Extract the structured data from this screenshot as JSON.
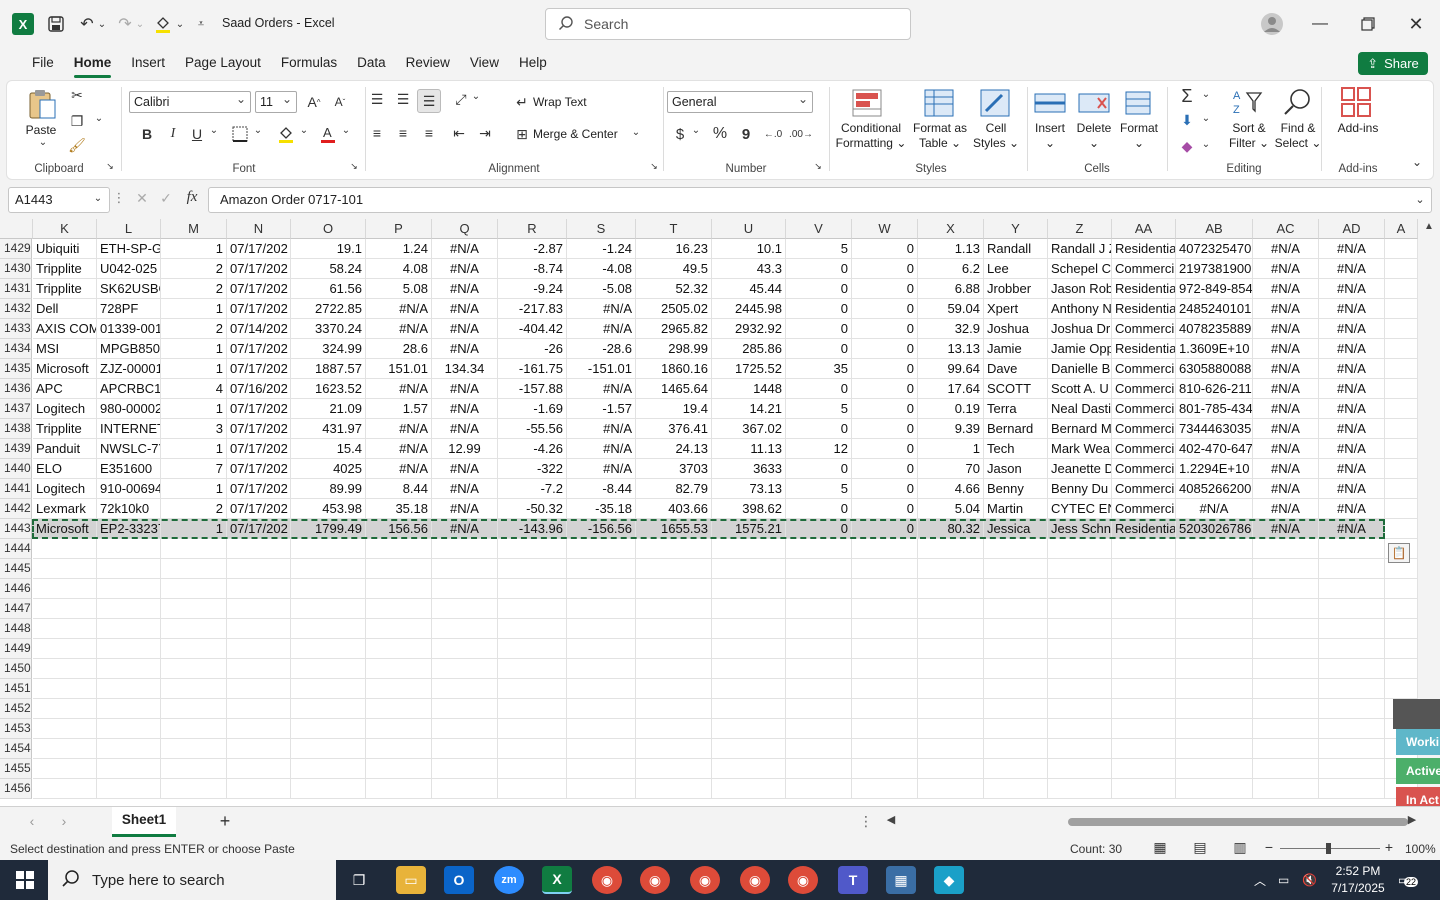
{
  "titlebar": {
    "app_icon": "X",
    "title": "Saad Orders  -  Excel",
    "search_placeholder": "Search"
  },
  "menu": {
    "tabs": [
      "File",
      "Home",
      "Insert",
      "Page Layout",
      "Formulas",
      "Data",
      "Review",
      "View",
      "Help"
    ],
    "active": "Home",
    "share_label": "Share"
  },
  "ribbon": {
    "clipboard": {
      "paste": "Paste",
      "group": "Clipboard"
    },
    "font": {
      "name": "Calibri",
      "size": "11",
      "bold": "B",
      "italic": "I",
      "underline": "U",
      "group": "Font"
    },
    "alignment": {
      "wrap": "Wrap Text",
      "merge": "Merge & Center",
      "group": "Alignment"
    },
    "number": {
      "format": "General",
      "currency": "$",
      "percent": "%",
      "comma": "9",
      "group": "Number"
    },
    "styles": {
      "conditional": "Conditional",
      "conditional2": "Formatting",
      "format_table": "Format as",
      "format_table2": "Table",
      "cell_styles": "Cell",
      "cell_styles2": "Styles",
      "group": "Styles"
    },
    "cells": {
      "insert": "Insert",
      "delete": "Delete",
      "format": "Format",
      "group": "Cells"
    },
    "editing": {
      "sigma": "Σ",
      "sort": "Sort &",
      "sort2": "Filter",
      "find": "Find &",
      "find2": "Select",
      "group": "Editing"
    },
    "addins": {
      "label": "Add-ins",
      "group": "Add-ins"
    }
  },
  "formula_bar": {
    "name_box": "A1443",
    "fx": "fx",
    "value": "Amazon Order 0717-101"
  },
  "grid": {
    "columns": [
      "K",
      "L",
      "M",
      "N",
      "O",
      "P",
      "Q",
      "R",
      "S",
      "T",
      "U",
      "V",
      "W",
      "X",
      "Y",
      "Z",
      "AA",
      "AB",
      "AC",
      "AD",
      "A"
    ],
    "rows": [
      {
        "n": "1429",
        "c": [
          "Ubiquiti",
          "ETH-SP-G2",
          "1",
          "07/17/202",
          "19.1",
          "1.24",
          "#N/A",
          "-2.87",
          "-1.24",
          "16.23",
          "10.1",
          "5",
          "0",
          "1.13",
          "Randall",
          "Randall J Z",
          "Residentia",
          "4072325470",
          "#N/A",
          "#N/A"
        ]
      },
      {
        "n": "1430",
        "c": [
          "Tripplite",
          "U042-025",
          "2",
          "07/17/202",
          "58.24",
          "4.08",
          "#N/A",
          "-8.74",
          "-4.08",
          "49.5",
          "43.3",
          "0",
          "0",
          "6.2",
          "Lee",
          "Schepel C",
          "Commerci",
          "2197381900",
          "#N/A",
          "#N/A"
        ]
      },
      {
        "n": "1431",
        "c": [
          "Tripplite",
          "SK62USBC",
          "2",
          "07/17/202",
          "61.56",
          "5.08",
          "#N/A",
          "-9.24",
          "-5.08",
          "52.32",
          "45.44",
          "0",
          "0",
          "6.88",
          "Jrobber",
          "Jason Rob",
          "Residentia",
          "972-849-854",
          "#N/A",
          "#N/A"
        ]
      },
      {
        "n": "1432",
        "c": [
          "Dell",
          "728PF",
          "1",
          "07/17/202",
          "2722.85",
          "#N/A",
          "#N/A",
          "-217.83",
          "#N/A",
          "2505.02",
          "2445.98",
          "0",
          "0",
          "59.04",
          "Xpert",
          "Anthony N",
          "Residentia",
          "2485240101",
          "#N/A",
          "#N/A"
        ]
      },
      {
        "n": "1433",
        "c": [
          "AXIS COM",
          "01339-001",
          "2",
          "07/14/202",
          "3370.24",
          "#N/A",
          "#N/A",
          "-404.42",
          "#N/A",
          "2965.82",
          "2932.92",
          "0",
          "0",
          "32.9",
          "Joshua",
          "Joshua Dr",
          "Commerci",
          "4078235889",
          "#N/A",
          "#N/A"
        ]
      },
      {
        "n": "1434",
        "c": [
          "MSI",
          "MPGB850E",
          "1",
          "07/17/202",
          "324.99",
          "28.6",
          "#N/A",
          "-26",
          "-28.6",
          "298.99",
          "285.86",
          "0",
          "0",
          "13.13",
          "Jamie",
          "Jamie Opp",
          "Residentia",
          "1.3609E+10",
          "#N/A",
          "#N/A"
        ]
      },
      {
        "n": "1435",
        "c": [
          "Microsoft",
          "ZJZ-00001",
          "1",
          "07/17/202",
          "1887.57",
          "151.01",
          "134.34",
          "-161.75",
          "-151.01",
          "1860.16",
          "1725.52",
          "35",
          "0",
          "99.64",
          "Dave",
          "Danielle B",
          "Commerci",
          "6305880088",
          "#N/A",
          "#N/A"
        ]
      },
      {
        "n": "1436",
        "c": [
          "APC",
          "APCRBC15",
          "4",
          "07/16/202",
          "1623.52",
          "#N/A",
          "#N/A",
          "-157.88",
          "#N/A",
          "1465.64",
          "1448",
          "0",
          "0",
          "17.64",
          "SCOTT",
          "Scott A. U",
          "Commerci",
          "810-626-211",
          "#N/A",
          "#N/A"
        ]
      },
      {
        "n": "1437",
        "c": [
          "Logitech",
          "980-00002",
          "1",
          "07/17/202",
          "21.09",
          "1.57",
          "#N/A",
          "-1.69",
          "-1.57",
          "19.4",
          "14.21",
          "5",
          "0",
          "0.19",
          "Terra",
          "Neal Dasti",
          "Commerci",
          "801-785-434",
          "#N/A",
          "#N/A"
        ]
      },
      {
        "n": "1438",
        "c": [
          "Tripplite",
          "INTERNET",
          "3",
          "07/17/202",
          "431.97",
          "#N/A",
          "#N/A",
          "-55.56",
          "#N/A",
          "376.41",
          "367.02",
          "0",
          "0",
          "9.39",
          "Bernard",
          "Bernard M",
          "Commerci",
          "7344463035",
          "#N/A",
          "#N/A"
        ]
      },
      {
        "n": "1439",
        "c": [
          "Panduit",
          "NWSLC-7Y",
          "1",
          "07/17/202",
          "15.4",
          "#N/A",
          "12.99",
          "-4.26",
          "#N/A",
          "24.13",
          "11.13",
          "12",
          "0",
          "1",
          "Tech",
          "Mark Wea",
          "Commerci",
          "402-470-647",
          "#N/A",
          "#N/A"
        ]
      },
      {
        "n": "1440",
        "c": [
          "ELO",
          "E351600",
          "7",
          "07/17/202",
          "4025",
          "#N/A",
          "#N/A",
          "-322",
          "#N/A",
          "3703",
          "3633",
          "0",
          "0",
          "70",
          "Jason",
          "Jeanette D",
          "Commerci",
          "1.2294E+10",
          "#N/A",
          "#N/A"
        ]
      },
      {
        "n": "1441",
        "c": [
          "Logitech",
          "910-00694",
          "1",
          "07/17/202",
          "89.99",
          "8.44",
          "#N/A",
          "-7.2",
          "-8.44",
          "82.79",
          "73.13",
          "5",
          "0",
          "4.66",
          "Benny",
          "Benny Du",
          "Commerci",
          "4085266200",
          "#N/A",
          "#N/A"
        ]
      },
      {
        "n": "1442",
        "c": [
          "Lexmark",
          "72k10k0",
          "2",
          "07/17/202",
          "453.98",
          "35.18",
          "#N/A",
          "-50.32",
          "-35.18",
          "403.66",
          "398.62",
          "0",
          "0",
          "5.04",
          "Martin",
          "CYTEC EN",
          "Commerci",
          "#N/A",
          "#N/A",
          "#N/A"
        ]
      },
      {
        "n": "1443",
        "c": [
          "Microsoft",
          "EP2-33237",
          "1",
          "07/17/202",
          "1799.49",
          "156.56",
          "#N/A",
          "-143.96",
          "-156.56",
          "1655.53",
          "1575.21",
          "0",
          "0",
          "80.32",
          "Jessica",
          "Jess Schne",
          "Residentia",
          "5203026786",
          "#N/A",
          "#N/A"
        ]
      }
    ],
    "empty_rows": [
      "1444",
      "1445",
      "1446",
      "1447",
      "1448",
      "1449",
      "1450",
      "1451",
      "1452",
      "1453",
      "1454",
      "1455",
      "1456"
    ]
  },
  "side_tags": [
    {
      "label": "Worki",
      "color": "#5fb7c9"
    },
    {
      "label": "Active",
      "color": "#4caf6a"
    },
    {
      "label": "In Act",
      "color": "#d9534f"
    }
  ],
  "sheets": {
    "tabs": [
      "Sheet1"
    ],
    "add": "+"
  },
  "status": {
    "message": "Select destination and press ENTER or choose Paste",
    "count": "Count: 30",
    "zoom": "100%"
  },
  "taskbar": {
    "search_placeholder": "Type here to search",
    "time": "2:52 PM",
    "date": "7/17/2025",
    "notifications": "22"
  },
  "colors": {
    "excel_green": "#107c41",
    "taskbar": "#1f2a3a"
  }
}
